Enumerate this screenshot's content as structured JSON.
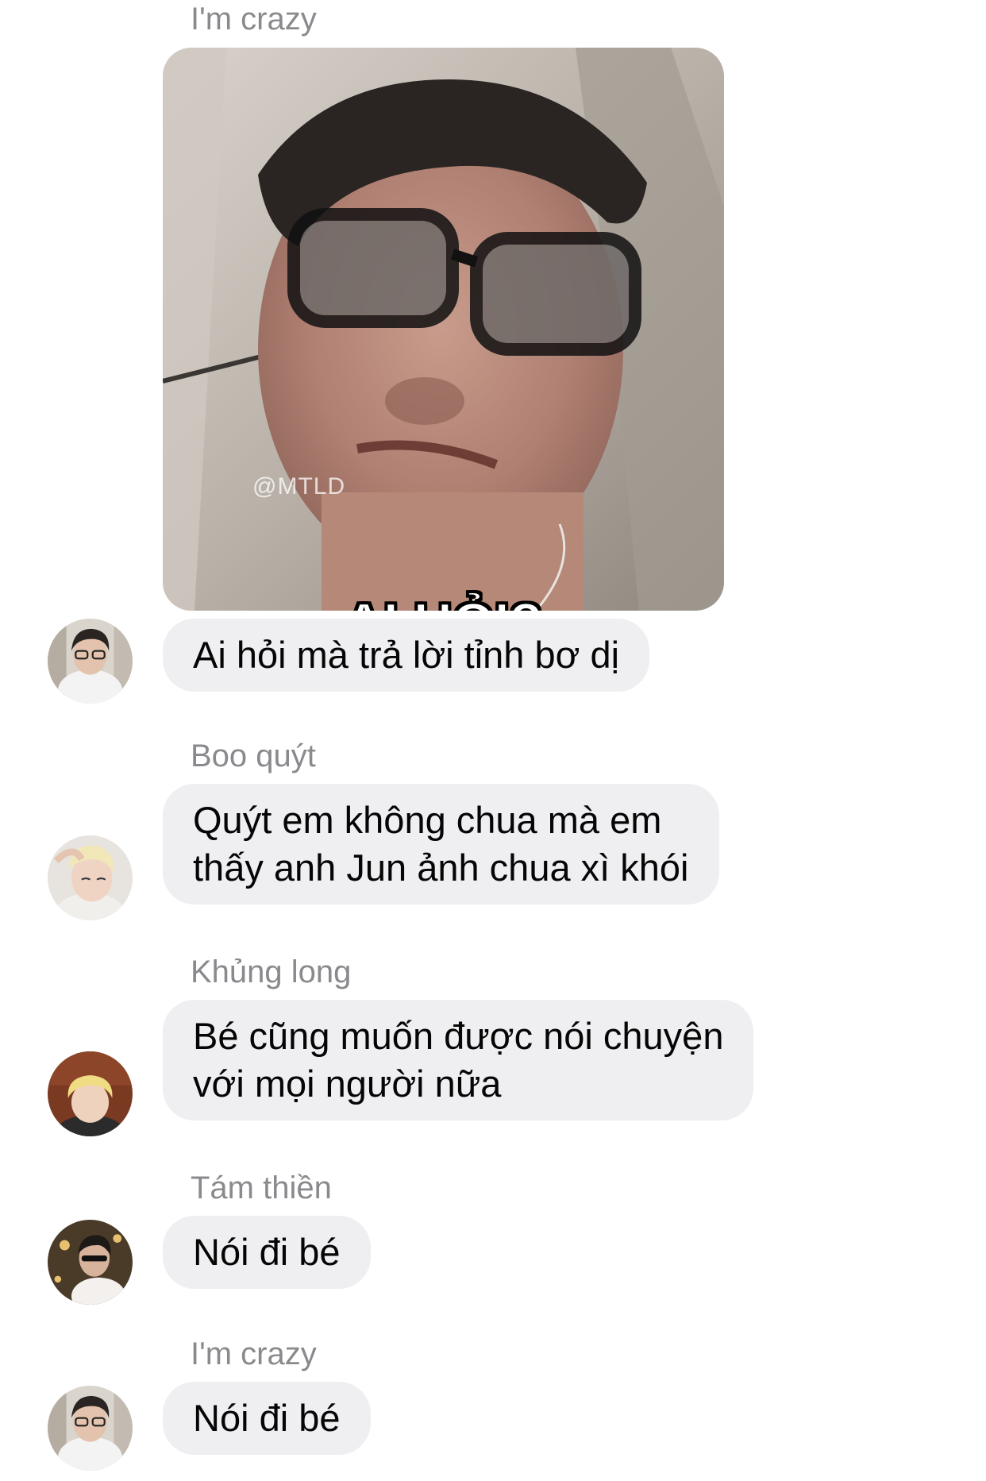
{
  "messages": [
    {
      "sender": "I'm crazy",
      "image": {
        "watermark": "@MTLD",
        "caption": "AI HỎI?"
      },
      "text_lines": [
        "Ai hỏi mà trả lời tỉnh bơ dị"
      ]
    },
    {
      "sender": "Boo quýt",
      "text_lines": [
        "Quýt em không chua mà em",
        "thấy anh Jun ảnh chua xì khói"
      ]
    },
    {
      "sender": "Khủng long",
      "text_lines": [
        "Bé cũng muốn được nói chuyện",
        "với mọi người nữa"
      ]
    },
    {
      "sender": "Tám thiền",
      "text_lines": [
        "Nói đi bé"
      ]
    },
    {
      "sender": "I'm crazy",
      "text_lines": [
        "Nói đi bé"
      ]
    }
  ],
  "colors": {
    "bubble": "#efeff2",
    "sender_name": "#8a8a8e",
    "text": "#050505"
  }
}
